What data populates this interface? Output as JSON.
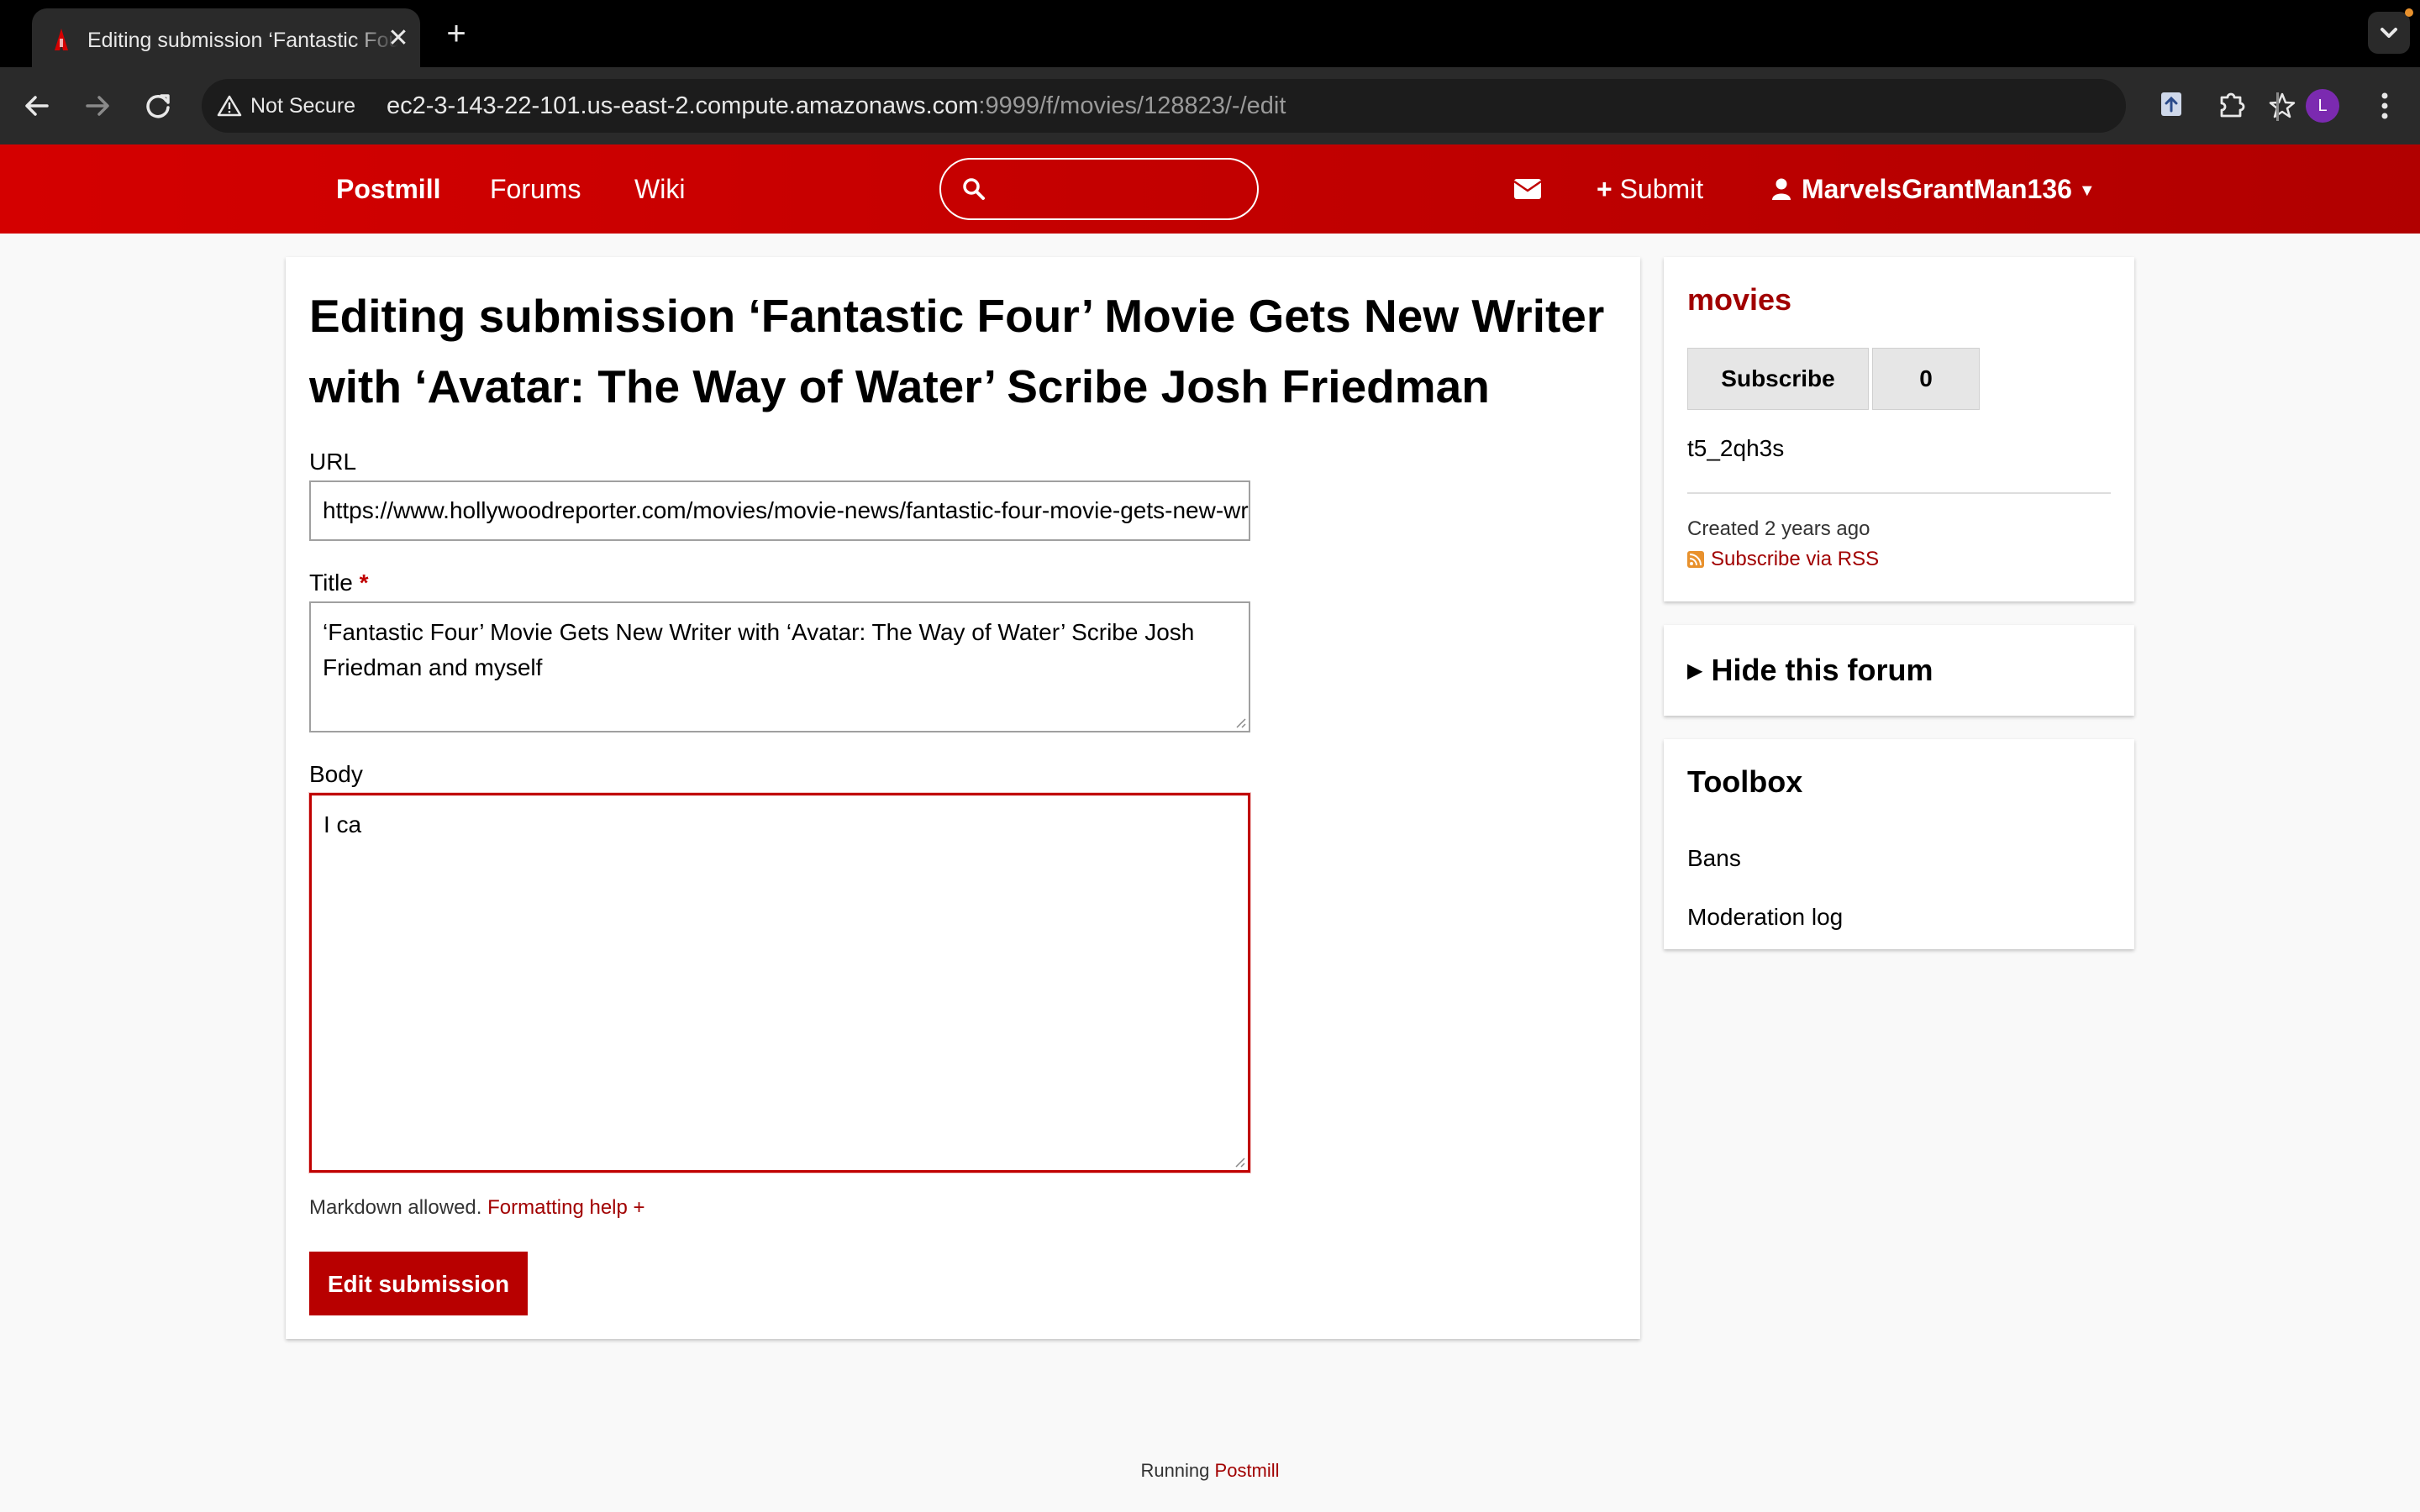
{
  "browser": {
    "tab_title": "Editing submission ‘Fantastic Four’ Movie Gets New Writer",
    "tab_close": "✕",
    "new_tab": "+",
    "not_secure_label": "Not Secure",
    "url_host": "ec2-3-143-22-101.us-east-2.compute.amazonaws.com",
    "url_path": ":9999/f/movies/128823/-/edit",
    "profile_initial": "L",
    "accent_colors": {
      "tab_bg": "#2a2a2a",
      "chrome_bg": "#000000",
      "profile": "#7b2ab0"
    }
  },
  "header": {
    "brand": "Postmill",
    "nav": [
      "Forums",
      "Wiki"
    ],
    "search_placeholder": "",
    "submit_label": "Submit",
    "username": "MarvelsGrantMan136",
    "brand_color": "#c00000"
  },
  "form": {
    "page_title": "Editing submission ‘Fantastic Four’ Movie Gets New Writer with ‘Avatar: The Way of Water’ Scribe Josh Friedman",
    "url_label": "URL",
    "url_value": "https://www.hollywoodreporter.com/movies/movie-news/fantastic-four-movie-gets-new-writer-avatar-the-way-of-water-josh-friedman",
    "title_label": "Title",
    "required_mark": "*",
    "title_value": "‘Fantastic Four’ Movie Gets New Writer with ‘Avatar: The Way of Water’ Scribe Josh Friedman and myself",
    "body_label": "Body",
    "body_value": "I ca",
    "markdown_note": "Markdown allowed.",
    "formatting_help": "Formatting help +",
    "edit_button": "Edit submission"
  },
  "sidebar": {
    "forum_name": "movies",
    "subscribe_label": "Subscribe",
    "subscriber_count": "0",
    "forum_id": "t5_2qh3s",
    "created": "Created 2 years ago",
    "rss_label": "Subscribe via RSS",
    "hide_forum": "Hide this forum",
    "toolbox_title": "Toolbox",
    "toolbox_links": [
      "Bans",
      "Moderation log"
    ]
  },
  "footer": {
    "running": "Running",
    "postmill": "Postmill"
  }
}
